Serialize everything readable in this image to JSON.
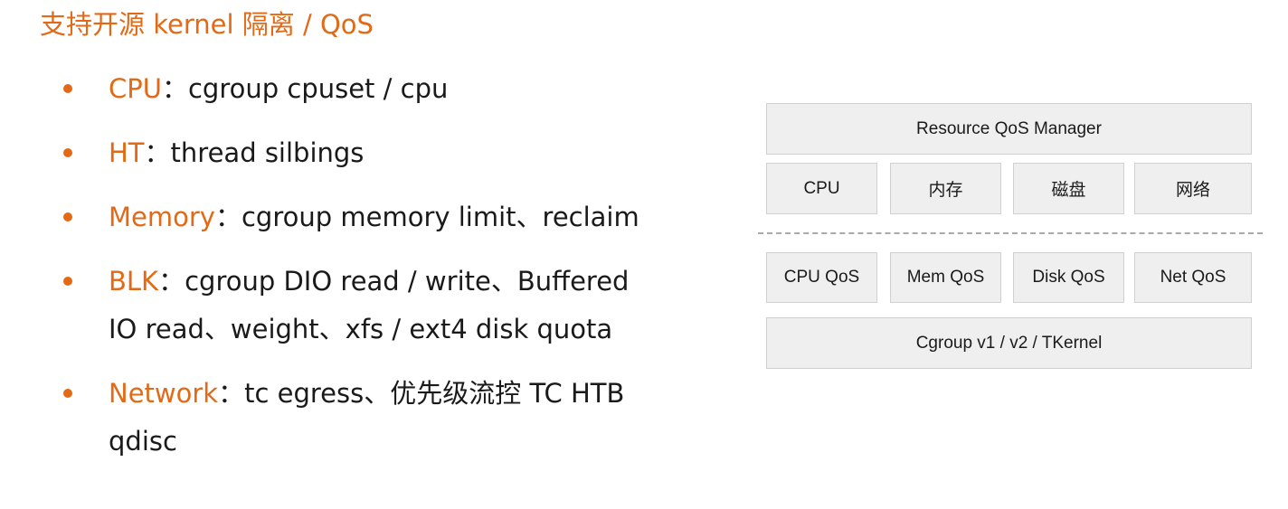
{
  "title": "支持开源 kernel 隔离 / QoS",
  "bullets": [
    {
      "key": "CPU",
      "sep": "：",
      "lines": [
        "cgroup cpuset / cpu"
      ]
    },
    {
      "key": "HT",
      "sep": "：",
      "lines": [
        "thread silbings"
      ]
    },
    {
      "key": "Memory",
      "sep": "：",
      "lines": [
        "cgroup memory limit、reclaim"
      ]
    },
    {
      "key": "BLK",
      "sep": "：",
      "lines": [
        "cgroup DIO read / write、Buffered",
        "IO read、weight、xfs / ext4 disk quota"
      ]
    },
    {
      "key": "Network",
      "sep": "：",
      "lines": [
        "tc egress、优先级流控 TC HTB",
        "qdisc"
      ]
    }
  ],
  "diagram": {
    "top_box": "Resource QoS Manager",
    "resources": [
      "CPU",
      "内存",
      "磁盘",
      "网络"
    ],
    "qos": [
      "CPU QoS",
      "Mem QoS",
      "Disk QoS",
      "Net QoS"
    ],
    "bottom_box": "Cgroup v1 / v2 / TKernel"
  }
}
